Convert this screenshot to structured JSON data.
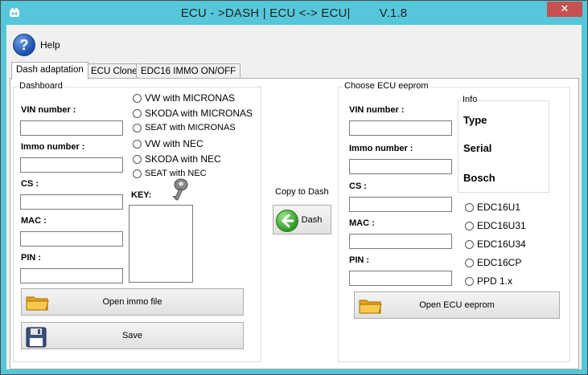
{
  "window": {
    "title": "ECU - >DASH | ECU <-> ECU|",
    "version": "V.1.8",
    "close_symbol": "✕"
  },
  "toolbar": {
    "help_label": "Help",
    "help_icon_glyph": "?"
  },
  "tabs": [
    {
      "label": "Dash adaptation",
      "active": true
    },
    {
      "label": "ECU Clone",
      "active": false
    },
    {
      "label": "EDC16 IMMO ON/OFF",
      "active": false
    }
  ],
  "dashboard": {
    "group_title": "Dashboard",
    "vin_label": "VIN number :",
    "immo_label": "Immo number :",
    "cs_label": "CS :",
    "mac_label": "MAC :",
    "pin_label": "PIN :",
    "vin_value": "",
    "immo_value": "",
    "cs_value": "",
    "mac_value": "",
    "pin_value": "",
    "radios": [
      "VW with MICRONAS",
      "SKODA with MICRONAS",
      "SEAT with MICRONAS",
      "VW with NEC",
      "SKODA with NEC",
      "SEAT with NEC"
    ],
    "key_label": "KEY:",
    "open_button": "Open immo file",
    "save_button": "Save"
  },
  "copy": {
    "label": "Copy to Dash",
    "button": "Dash"
  },
  "ecu": {
    "group_title": "Choose ECU eeprom",
    "vin_label": "VIN number :",
    "immo_label": "Immo number :",
    "cs_label": "CS :",
    "mac_label": "MAC :",
    "pin_label": "PIN :",
    "vin_value": "",
    "immo_value": "",
    "cs_value": "",
    "mac_value": "",
    "pin_value": "",
    "info_title": "Info",
    "info_type": "Type",
    "info_serial": "Serial",
    "info_bosch": "Bosch",
    "radios": [
      "EDC16U1",
      "EDC16U31",
      "EDC16U34",
      "EDC16CP",
      "PPD 1.x"
    ],
    "open_button": "Open ECU eeprom"
  }
}
